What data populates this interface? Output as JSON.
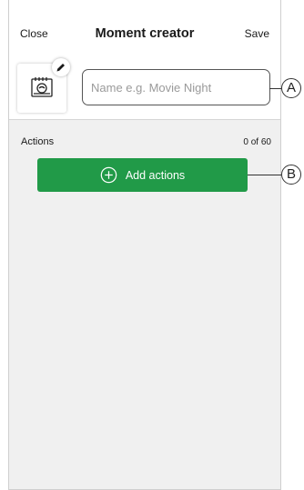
{
  "header": {
    "close_label": "Close",
    "title": "Moment creator",
    "save_label": "Save"
  },
  "name_field": {
    "value": "",
    "placeholder": "Name e.g. Movie Night"
  },
  "actions": {
    "label": "Actions",
    "count": "0 of 60",
    "add_button_label": "Add actions"
  },
  "callouts": {
    "a": "A",
    "b": "B"
  },
  "colors": {
    "accent_green": "#219a48",
    "background_gray": "#f0f0f0"
  },
  "icons": {
    "moment": "moment-icon",
    "edit": "pencil-icon",
    "add": "plus-circle-icon"
  }
}
